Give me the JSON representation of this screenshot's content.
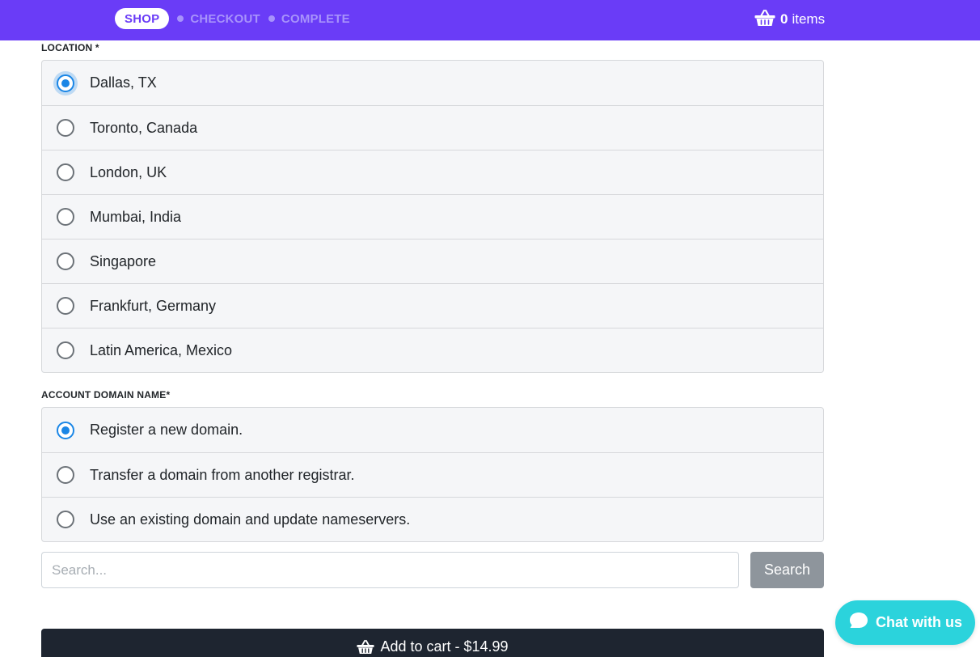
{
  "header": {
    "steps": [
      {
        "label": "SHOP",
        "active": true
      },
      {
        "label": "CHECKOUT",
        "active": false
      },
      {
        "label": "COMPLETE",
        "active": false
      }
    ],
    "cart": {
      "icon": "basket-icon",
      "count": "0",
      "word": "items"
    }
  },
  "location": {
    "label": "LOCATION *",
    "selected": "Dallas, TX",
    "options": [
      {
        "label": "Dallas, TX",
        "checked": true
      },
      {
        "label": "Toronto, Canada",
        "checked": false
      },
      {
        "label": "London, UK",
        "checked": false
      },
      {
        "label": "Mumbai, India",
        "checked": false
      },
      {
        "label": "Singapore",
        "checked": false
      },
      {
        "label": "Frankfurt, Germany",
        "checked": false
      },
      {
        "label": "Latin America, Mexico",
        "checked": false
      }
    ]
  },
  "domain": {
    "label": "ACCOUNT DOMAIN NAME*",
    "selected": "Register a new domain.",
    "options": [
      {
        "label": "Register a new domain.",
        "checked": true
      },
      {
        "label": "Transfer a domain from another registrar.",
        "checked": false
      },
      {
        "label": "Use an existing domain and update nameservers.",
        "checked": false
      }
    ]
  },
  "search": {
    "placeholder": "Search...",
    "value": "",
    "button_label": "Search"
  },
  "add_to_cart": {
    "icon": "basket-icon",
    "label": "Add to cart - $14.99"
  },
  "chat": {
    "icon": "chat-bubble-icon",
    "label": "Chat with us"
  },
  "colors": {
    "brand": "#6a3cf7",
    "radio_checked": "#1a86e6",
    "dark_button": "#1e2530",
    "chat": "#2bd3dc",
    "search_button": "#8e959c"
  }
}
